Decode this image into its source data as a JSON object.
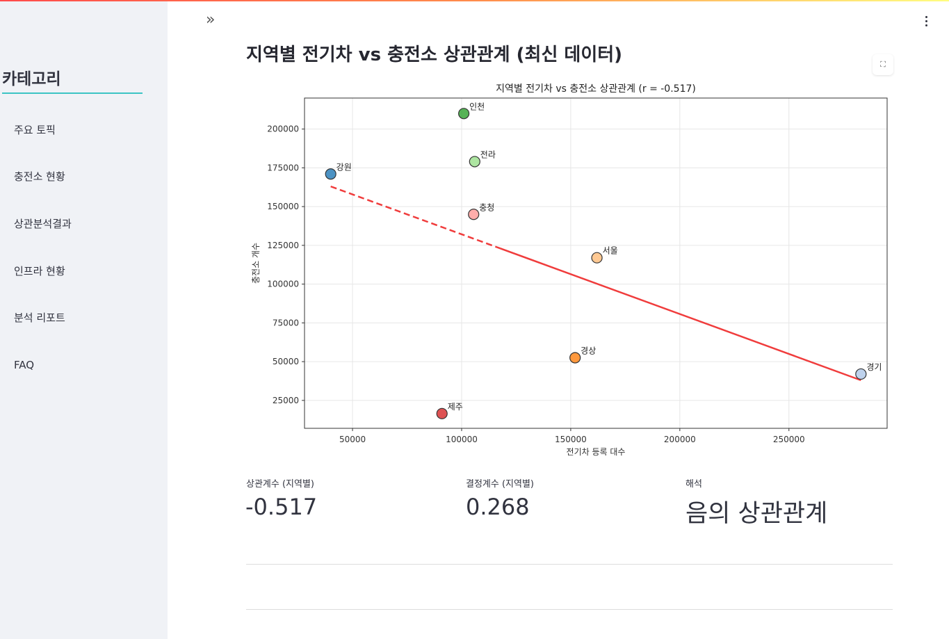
{
  "sidebar": {
    "title": "카테고리",
    "items": [
      {
        "label": "주요 토픽"
      },
      {
        "label": "충전소 현황"
      },
      {
        "label": "상관분석결과"
      },
      {
        "label": "인프라 현황"
      },
      {
        "label": "분석 리포트"
      },
      {
        "label": "FAQ"
      }
    ]
  },
  "header": {
    "collapse_icon": "»",
    "menu_icon": "more-vertical"
  },
  "main": {
    "title": "지역별 전기차 vs 충전소 상관관계 (최신 데이터)",
    "metrics": [
      {
        "label": "상관계수 (지역별)",
        "value": "-0.517"
      },
      {
        "label": "결정계수 (지역별)",
        "value": "0.268"
      },
      {
        "label": "해석",
        "value": "음의 상관관계"
      }
    ]
  },
  "chart_data": {
    "type": "scatter",
    "title": "지역별 전기차 vs 충전소 상관관계 (r = -0.517)",
    "xlabel": "전기차 등록 대수",
    "ylabel": "충전소 개수",
    "xlim": [
      28000,
      295000
    ],
    "ylim": [
      7000,
      220000
    ],
    "xticks": [
      50000,
      100000,
      150000,
      200000,
      250000
    ],
    "yticks": [
      25000,
      50000,
      75000,
      100000,
      125000,
      150000,
      175000,
      200000
    ],
    "grid": true,
    "points": [
      {
        "label": "강원",
        "x": 40000,
        "y": 171000,
        "color": "#1f77b4"
      },
      {
        "label": "인천",
        "x": 101000,
        "y": 210000,
        "color": "#2ca02c"
      },
      {
        "label": "전라",
        "x": 106000,
        "y": 179000,
        "color": "#98df8a"
      },
      {
        "label": "충청",
        "x": 105500,
        "y": 145000,
        "color": "#ff9896"
      },
      {
        "label": "서울",
        "x": 162000,
        "y": 117000,
        "color": "#ffbb78"
      },
      {
        "label": "경상",
        "x": 152000,
        "y": 52500,
        "color": "#ff7f0e"
      },
      {
        "label": "경기",
        "x": 283000,
        "y": 42000,
        "color": "#aec7e8"
      },
      {
        "label": "제주",
        "x": 91000,
        "y": 16500,
        "color": "#d62728"
      }
    ],
    "trendline": {
      "x": [
        40000,
        283000
      ],
      "y": [
        163000,
        38000
      ],
      "color": "#f03c3c"
    }
  }
}
